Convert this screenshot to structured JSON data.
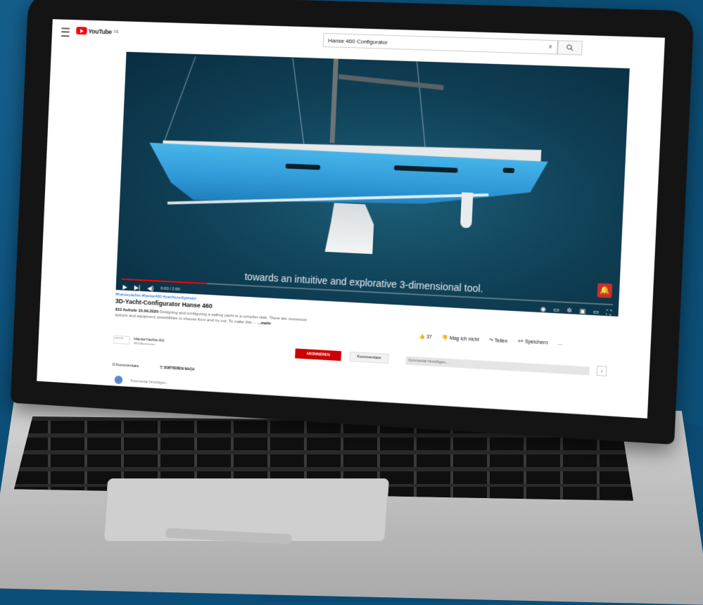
{
  "app": {
    "logo_text": "YouTube",
    "logo_sup": "DE"
  },
  "search": {
    "query": "Hanse 460 Configurator",
    "clear": "×",
    "icon": "search-icon"
  },
  "player": {
    "subtitle": "towards an intuitive and explorative 3-dimensional tool.",
    "time": "0:00 / 2:00",
    "progress_fraction": 0.18,
    "play_icon": "▶",
    "next_icon": "▶|",
    "volume_icon": "◀)",
    "bell_icon": "🔔"
  },
  "video": {
    "channel_tags": "#hanseyachts #hanse460 #yachtconfigurator",
    "title": "3D-Yacht-Configurator Hanse 460",
    "views_date": "333 Aufrufe 10.09.2020",
    "description": "Designing and configuring a sailing yacht is a complex task. There are numerous options and equipment possibilities to choose from and try out. To make this ...",
    "more": "...mehr"
  },
  "actions": {
    "like": "37",
    "dislike": "Mag ich nicht",
    "share": "Teilen",
    "save": "Speichern",
    "more": "..."
  },
  "channel": {
    "name": "HanseYachts AG",
    "subs": "4800 Abonnenten",
    "avatar_text": "HANSE"
  },
  "subscribe": "ABONNIEREN",
  "comments_tab": "Kommentare",
  "comment_placeholder": "Kommentar hinzufügen...",
  "chevron": "›",
  "comments": {
    "count": "0 Kommentare",
    "sort": "SORTIEREN NACH",
    "add": "Kommentar hinzufügen..."
  }
}
